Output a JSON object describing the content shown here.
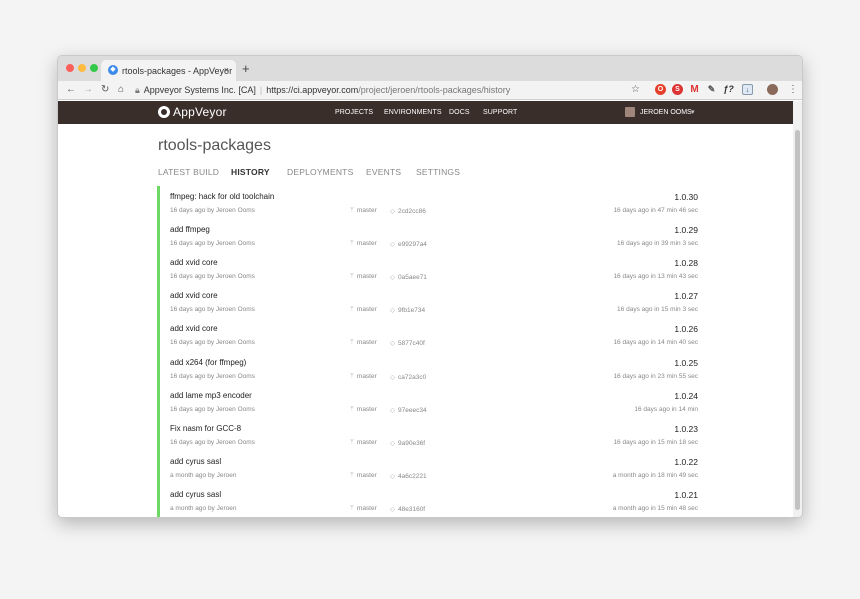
{
  "browser": {
    "tab_title": "rtools-packages - AppVeyor",
    "tab_close": "×",
    "new_tab": "+",
    "site_identity": "Appveyor Systems Inc. [CA]",
    "url_host": "https://ci.appveyor.com",
    "url_path": "/project/jeroen/rtools-packages/history",
    "traffic_colors": [
      "#fc605c",
      "#fdbc40",
      "#34c84a"
    ]
  },
  "app": {
    "logo": "AppVeyor",
    "nav": [
      "PROJECTS",
      "ENVIRONMENTS",
      "DOCS",
      "SUPPORT"
    ],
    "user": "JEROEN OOMS",
    "header_color": "#3a2e2a"
  },
  "project": {
    "title": "rtools-packages",
    "tabs": [
      "LATEST BUILD",
      "HISTORY",
      "DEPLOYMENTS",
      "EVENTS",
      "SETTINGS"
    ],
    "active_tab": "HISTORY"
  },
  "history": {
    "status_color": "#6ed864",
    "builds": [
      {
        "message": "ffmpeg: hack for old toolchain",
        "meta": "16 days ago by Jeroen Ooms",
        "branch": "master",
        "commit": "2cd2cc86",
        "version": "1.0.30",
        "duration": "16 days ago in 47 min 46 sec"
      },
      {
        "message": "add ffmpeg",
        "meta": "16 days ago by Jeroen Ooms",
        "branch": "master",
        "commit": "e99297a4",
        "version": "1.0.29",
        "duration": "16 days ago in 39 min 3 sec"
      },
      {
        "message": "add xvid core",
        "meta": "16 days ago by Jeroen Ooms",
        "branch": "master",
        "commit": "0a5aee71",
        "version": "1.0.28",
        "duration": "16 days ago in 13 min 43 sec"
      },
      {
        "message": "add xvid core",
        "meta": "16 days ago by Jeroen Ooms",
        "branch": "master",
        "commit": "9fb1e734",
        "version": "1.0.27",
        "duration": "16 days ago in 15 min 3 sec"
      },
      {
        "message": "add xvid core",
        "meta": "16 days ago by Jeroen Ooms",
        "branch": "master",
        "commit": "5877c40f",
        "version": "1.0.26",
        "duration": "16 days ago in 14 min 40 sec"
      },
      {
        "message": "add x264 (for ffmpeg)",
        "meta": "16 days ago by Jeroen Ooms",
        "branch": "master",
        "commit": "ca72a3c0",
        "version": "1.0.25",
        "duration": "16 days ago in 23 min 55 sec"
      },
      {
        "message": "add lame mp3 encoder",
        "meta": "16 days ago by Jeroen Ooms",
        "branch": "master",
        "commit": "97eeec34",
        "version": "1.0.24",
        "duration": "16 days ago in 14 min"
      },
      {
        "message": "Fix nasm for GCC-8",
        "meta": "16 days ago by Jeroen Ooms",
        "branch": "master",
        "commit": "9a90e36f",
        "version": "1.0.23",
        "duration": "16 days ago in 15 min 18 sec"
      },
      {
        "message": "add cyrus sasl",
        "meta": "a month ago by Jeroen",
        "branch": "master",
        "commit": "4a6c2221",
        "version": "1.0.22",
        "duration": "a month ago in 18 min 49 sec"
      },
      {
        "message": "add cyrus sasl",
        "meta": "a month ago by Jeroen",
        "branch": "master",
        "commit": "48e3160f",
        "version": "1.0.21",
        "duration": "a month ago in 15 min 48 sec"
      }
    ]
  }
}
